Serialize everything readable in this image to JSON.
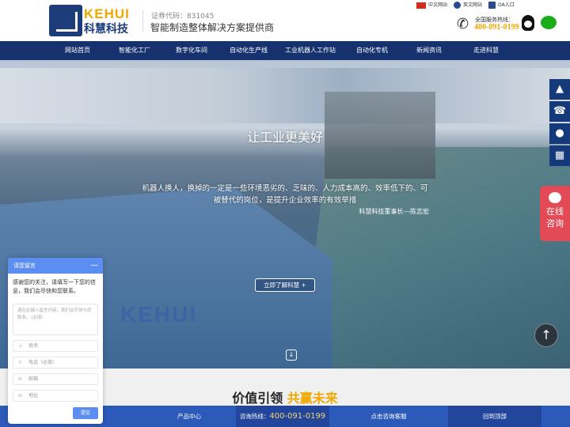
{
  "header": {
    "brand_en": "KEHUI",
    "brand_cn": "科慧科技",
    "stock_code": "证券代码：831045",
    "slogan": "智能制造整体解决方案提供商",
    "top_links": [
      {
        "label": "中文网站",
        "icon": "china-flag-icon"
      },
      {
        "label": "英文网站",
        "icon": "globe-icon"
      },
      {
        "label": "OA入口",
        "icon": "oa-icon"
      }
    ],
    "hotline_label": "全国服务热线：",
    "hotline": "400-091-0199"
  },
  "nav": [
    "网站首页",
    "智能化工厂",
    "数字化车间",
    "自动化生产线",
    "工业机器人工作站",
    "自动化专机",
    "新闻资讯",
    "走进科慧"
  ],
  "hero": {
    "title": "让工业更美好",
    "text": "机器人换人，换掉的一定是一些环境恶劣的、乏味的、人力成本高的、效率低下的、可被替代的岗位，是提升企业效率的有效举措",
    "author": "科慧科技董事长---陈志宏",
    "button": "立即了解科慧  +",
    "logo_text": "KEHUI"
  },
  "side_tools": [
    "top-icon",
    "phone-icon",
    "qq-icon",
    "qrcode-icon"
  ],
  "online": {
    "label1": "在线",
    "label2": "咨询"
  },
  "section": {
    "title_a": "价值引领",
    "title_b": "共赢未来"
  },
  "bottom_bar": {
    "products": "产品中心",
    "hotline_label": "咨询热线：",
    "hotline": "400-091-0199",
    "service": "点击咨询客服",
    "top": "回到顶部"
  },
  "chat": {
    "title": "请您留言",
    "intro": "感谢您的关注，请填写一下您的信息，我们会尽快和您联系。",
    "textarea_placeholder": "请在此输入留言内容，我们会尽快与您联系。（必填）",
    "fields": [
      "姓名",
      "电话（必填）",
      "邮箱",
      "地址"
    ],
    "submit": "提交"
  },
  "colors": {
    "nav": "#15326e",
    "accent": "#f0a800",
    "chat": "#5b8ef0",
    "online": "#e24a55"
  }
}
